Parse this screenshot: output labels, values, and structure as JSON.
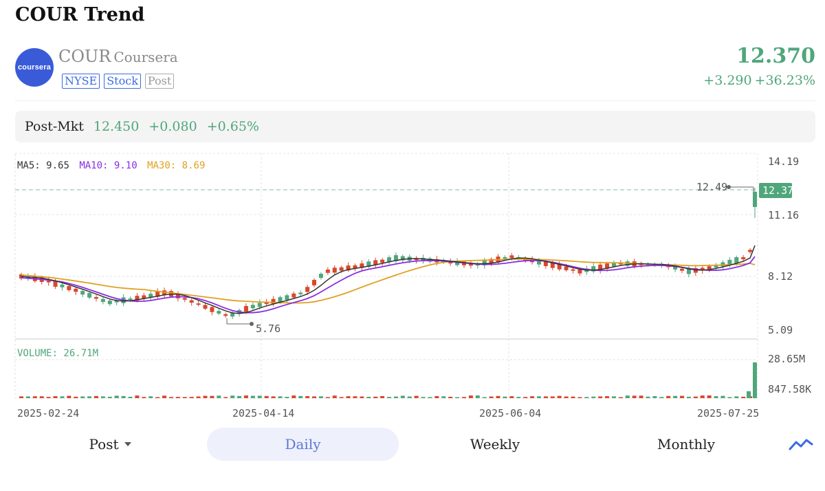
{
  "page_title": "COUR Trend",
  "stock": {
    "logo_text": "coursera",
    "symbol": "COUR",
    "company": "Coursera",
    "tags": [
      "NYSE",
      "Stock",
      "Post"
    ],
    "price": "12.370",
    "change": "+3.290",
    "change_pct": "+36.23%"
  },
  "post_market": {
    "label": "Post-Mkt",
    "price": "12.450",
    "change": "+0.080",
    "change_pct": "+0.65%"
  },
  "colors": {
    "up": "#4fa67a",
    "down": "#d9472b",
    "ma5": "#333333",
    "ma10": "#8a2be2",
    "ma30": "#e0a020",
    "accent": "#5a78d6"
  },
  "chart_data": {
    "type": "candlestick",
    "indicators": {
      "ma5_label": "MA5:",
      "ma5": "9.65",
      "ma10_label": "MA10:",
      "ma10": "9.10",
      "ma30_label": "MA30:",
      "ma30": "8.69"
    },
    "y_ticks": [
      "14.19",
      "11.16",
      "8.12",
      "5.09"
    ],
    "y_range": [
      5.09,
      14.19
    ],
    "price_marker": "12.37",
    "high_label": "12.49",
    "low_label": "5.76",
    "volume_label": "VOLUME: 26.71M",
    "volume_ticks": [
      "28.65M",
      "847.58K"
    ],
    "x_labels": [
      "2025-02-24",
      "2025-04-14",
      "2025-06-04",
      "2025-07-25"
    ]
  },
  "tabs": [
    {
      "label": "Post",
      "dropdown": true
    },
    {
      "label": "Daily",
      "active": true
    },
    {
      "label": "Weekly"
    },
    {
      "label": "Monthly"
    }
  ],
  "trend_icon": "line-chart-icon"
}
